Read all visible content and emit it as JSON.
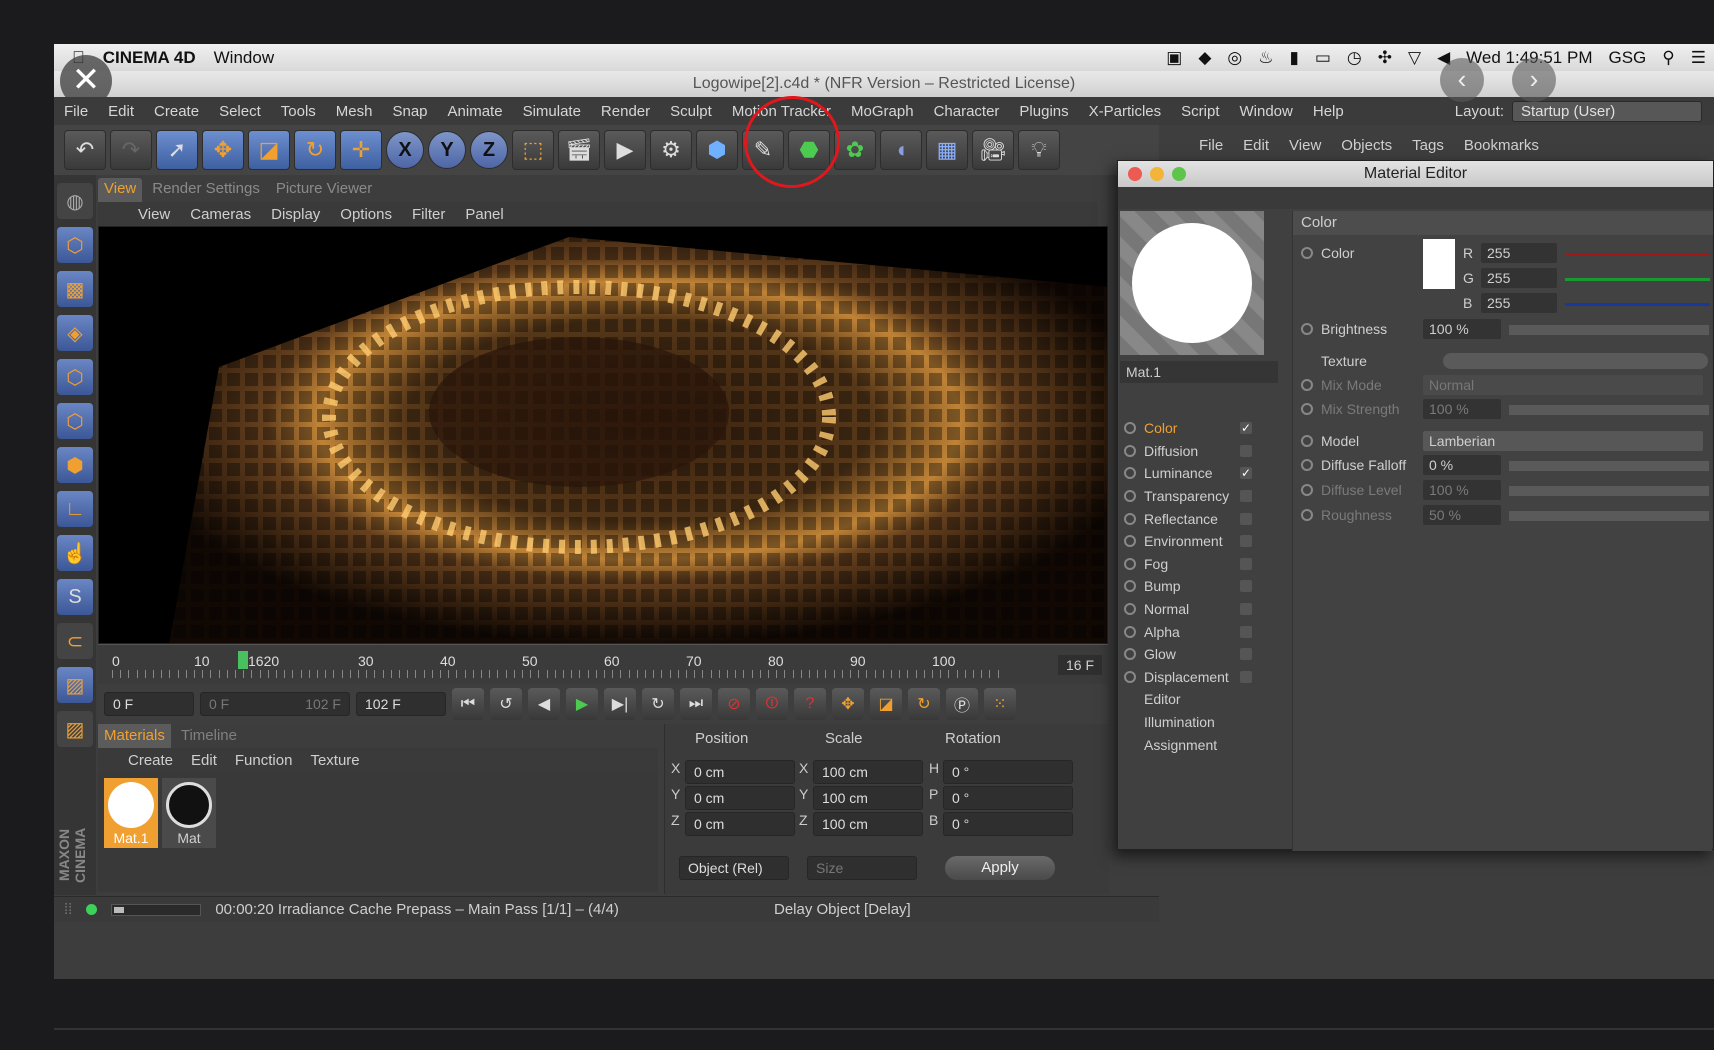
{
  "mac_menubar": {
    "app_name": "CINEMA 4D",
    "menu_window": "Window",
    "clock": "Wed 1:49:51 PM",
    "user": "GSG"
  },
  "window_title": "Logowipe[2].c4d * (NFR Version – Restricted License)",
  "menu": {
    "items": [
      "File",
      "Edit",
      "Create",
      "Select",
      "Tools",
      "Mesh",
      "Snap",
      "Animate",
      "Simulate",
      "Render",
      "Sculpt",
      "Motion Tracker",
      "MoGraph",
      "Character",
      "Plugins",
      "X-Particles",
      "Script",
      "Window",
      "Help"
    ],
    "layout_label": "Layout:",
    "layout_value": "Startup (User)"
  },
  "object_manager": {
    "items": [
      "File",
      "Edit",
      "View",
      "Objects",
      "Tags",
      "Bookmarks"
    ]
  },
  "viewport": {
    "tabs": [
      "View",
      "Render Settings",
      "Picture Viewer"
    ],
    "menu": [
      "View",
      "Cameras",
      "Display",
      "Options",
      "Filter",
      "Panel"
    ]
  },
  "timeline": {
    "ticks": [
      "0",
      "10",
      "1620",
      "30",
      "40",
      "50",
      "60",
      "70",
      "80",
      "90",
      "100"
    ],
    "current_frame": "16 F",
    "start": "0 F",
    "range_start": "0 F",
    "range_end": "102 F",
    "end": "102 F"
  },
  "materials": {
    "tabs": [
      "Materials",
      "Timeline"
    ],
    "menu": [
      "Create",
      "Edit",
      "Function",
      "Texture"
    ],
    "items": [
      "Mat.1",
      "Mat"
    ]
  },
  "coordinates": {
    "headers": [
      "Position",
      "Scale",
      "Rotation"
    ],
    "rows": [
      {
        "axis": "X",
        "pos": "0 cm",
        "saxis": "X",
        "scale": "100 cm",
        "raxis": "H",
        "rot": "0 °"
      },
      {
        "axis": "Y",
        "pos": "0 cm",
        "saxis": "Y",
        "scale": "100 cm",
        "raxis": "P",
        "rot": "0 °"
      },
      {
        "axis": "Z",
        "pos": "0 cm",
        "saxis": "Z",
        "scale": "100 cm",
        "raxis": "B",
        "rot": "0 °"
      }
    ],
    "mode": "Object (Rel)",
    "size": "Size",
    "apply": "Apply"
  },
  "status": {
    "text": "00:00:20 Irradiance Cache Prepass – Main Pass [1/1] – (4/4)",
    "object": "Delay Object [Delay]"
  },
  "material_editor": {
    "title": "Material Editor",
    "mat_name": "Mat.1",
    "channels": [
      {
        "name": "Color",
        "checked": "✓"
      },
      {
        "name": "Diffusion",
        "checked": ""
      },
      {
        "name": "Luminance",
        "checked": "✓"
      },
      {
        "name": "Transparency",
        "checked": ""
      },
      {
        "name": "Reflectance",
        "checked": ""
      },
      {
        "name": "Environment",
        "checked": ""
      },
      {
        "name": "Fog",
        "checked": ""
      },
      {
        "name": "Bump",
        "checked": ""
      },
      {
        "name": "Normal",
        "checked": ""
      },
      {
        "name": "Alpha",
        "checked": ""
      },
      {
        "name": "Glow",
        "checked": ""
      },
      {
        "name": "Displacement",
        "checked": ""
      }
    ],
    "extras": [
      "Editor",
      "Illumination",
      "Assignment"
    ],
    "section": "Color",
    "color_label": "Color",
    "r_label": "R",
    "r": "255",
    "g_label": "G",
    "g": "255",
    "b_label": "B",
    "b": "255",
    "brightness_label": "Brightness",
    "brightness": "100 %",
    "texture_label": "Texture",
    "mix_mode_label": "Mix Mode",
    "mix_mode": "Normal",
    "mix_strength_label": "Mix Strength",
    "mix_strength": "100 %",
    "model_label": "Model",
    "model": "Lamberian",
    "diffuse_falloff_label": "Diffuse Falloff",
    "diffuse_falloff": "0 %",
    "diffuse_level_label": "Diffuse Level",
    "diffuse_level": "100 %",
    "roughness_label": "Roughness",
    "roughness": "50 %"
  },
  "colors": {
    "accent": "#f0a030",
    "annotation": "#e0181d",
    "status_ok": "#3cd158"
  }
}
